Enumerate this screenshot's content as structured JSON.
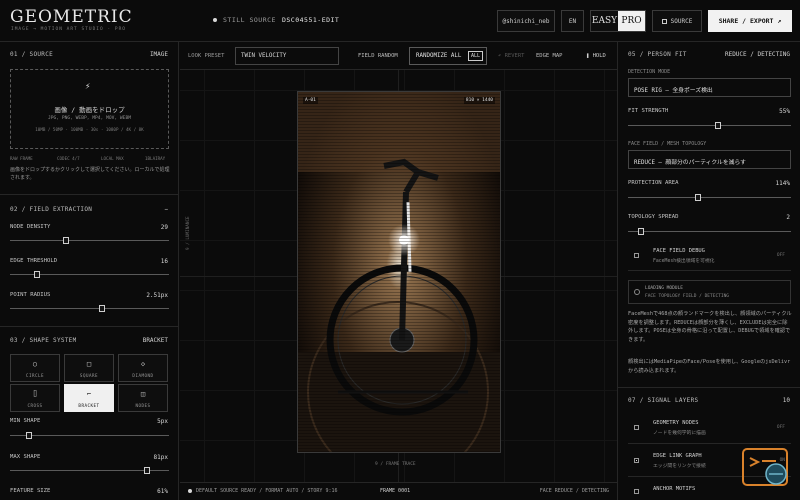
{
  "header": {
    "logo": "GEOMETRIC",
    "logo_sub": "IMAGE → MOTION ART STUDIO · PRO",
    "status_label": "STILL SOURCE",
    "status_file": "DSC04551-EDIT",
    "user": "@shinichi_neb",
    "lang": "EN",
    "mode_easy": "EASY",
    "mode_pro": "PRO",
    "source_btn": "SOURCE",
    "share_btn": "SHARE / EXPORT ↗"
  },
  "left": {
    "source": {
      "title": "01 / SOURCE",
      "right": "IMAGE",
      "drop_icon": "⚡",
      "drop_title": "画像 / 動画をドロップ",
      "drop_formats": "JPG, PNG, WEBP, MP4, MOV, WEBM",
      "drop_limits": "10MB / 50MP · 100MB · 30s · 1080P / 4K / 8K",
      "meta": [
        "RAW FRAME",
        "CODEC 4/7",
        "LOCAL MAX",
        "1BLAIRAY"
      ],
      "note": "画像をドロップするかクリックして選択してください。ローカルで処理されます。"
    },
    "field": {
      "title": "02 / FIELD EXTRACTION",
      "right": "−",
      "node_density_label": "NODE DENSITY",
      "node_density_value": "29",
      "node_density": 0.35,
      "edge_threshold_label": "EDGE THRESHOLD",
      "edge_threshold_value": "16",
      "edge_threshold": 0.17,
      "point_radius_label": "POINT RADIUS",
      "point_radius_value": "2.51px",
      "point_radius": 0.58
    },
    "shape": {
      "title": "03 / SHAPE SYSTEM",
      "right": "BRACKET",
      "items": [
        {
          "glyph": "○",
          "name": "CIRCLE"
        },
        {
          "glyph": "□",
          "name": "SQUARE"
        },
        {
          "glyph": "◇",
          "name": "DIAMOND"
        },
        {
          "glyph": "⌷",
          "name": "CROSS"
        },
        {
          "glyph": "⌐",
          "name": "BRACKET"
        },
        {
          "glyph": "◫",
          "name": "NODES"
        }
      ],
      "min_label": "MIN SHAPE",
      "min_value": "5px",
      "min": 0.12,
      "max_label": "MAX SHAPE",
      "max_value": "81px",
      "max": 0.86,
      "feature_label": "FEATURE SIZE",
      "feature_value": "61%"
    }
  },
  "toolbar": {
    "look_preset_label": "LOOK PRESET",
    "look_preset": "TWIN VELOCITY",
    "field_random": "FIELD RANDOM",
    "randomize": "RANDOMIZE ALL",
    "randomize_key": "ALL",
    "revert": "↶ REVERT",
    "edge_map": "EDGE MAP",
    "hold": "❚ HOLD"
  },
  "canvas": {
    "tag_left": "A-01",
    "tag_right": "810 × 1440",
    "side_label": "9 / LUMINANCE",
    "bottom_label": "9 / FRAME TRACE"
  },
  "statusbar": {
    "left": "DEFAULT SOURCE READY / FORMAT AUTO / STORY 9:16",
    "center": "FRAME 0001",
    "right": "FACE REDUCE / DETECTING"
  },
  "right": {
    "person": {
      "title": "05 / PERSON FIT",
      "right": "REDUCE / DETECTING",
      "mode_label": "DETECTION MODE",
      "mode_value": "POSE RIG — 全身ポーズ検出",
      "fit_label": "FIT STRENGTH",
      "fit_value": "55%",
      "fit": 0.55,
      "topo_label": "FACE FIELD / MESH TOPOLOGY",
      "topo_value": "REDUCE — 顔部分のパーティクルを減らす",
      "prot_label": "PROTECTION AREA",
      "prot_value": "114%",
      "prot": 0.43,
      "spread_label": "TOPOLOGY SPREAD",
      "spread_value": "2",
      "spread": 0.08,
      "debug_title": "FACE FIELD DEBUG",
      "debug_sub": "FaceMesh検出領域を可視化",
      "debug_state": "OFF",
      "loading_title": "LOADING MODULE",
      "loading_sub": "FACE TOPOLOGY FIELD / DETECTING",
      "desc1": "FaceMeshで468点の顔ランドマークを検出し、顔領域のパーティクル密度を調整します。REDUCEは顔部分を薄くし、EXCLUDEは完全に除外します。POSEは全身の骨格に沿って配置し、DEBUGで領域を確認できます。",
      "desc2": "顔検出にはMediaPipeのFace/Poseを使用し、GoogleのjsDelivrから読み込まれます。"
    },
    "signal": {
      "title": "07 / SIGNAL LAYERS",
      "right": "10",
      "rows": [
        {
          "title": "GEOMETRY NODES",
          "sub": "ノードを幾何学的に描画",
          "state": "OFF",
          "checked": false
        },
        {
          "title": "EDGE LINK GRAPH",
          "sub": "エッジ間をリンクで接続",
          "state": "ON",
          "checked": true
        },
        {
          "title": "ANCHOR MOTIFS",
          "sub": "",
          "state": "",
          "checked": false
        }
      ]
    }
  }
}
